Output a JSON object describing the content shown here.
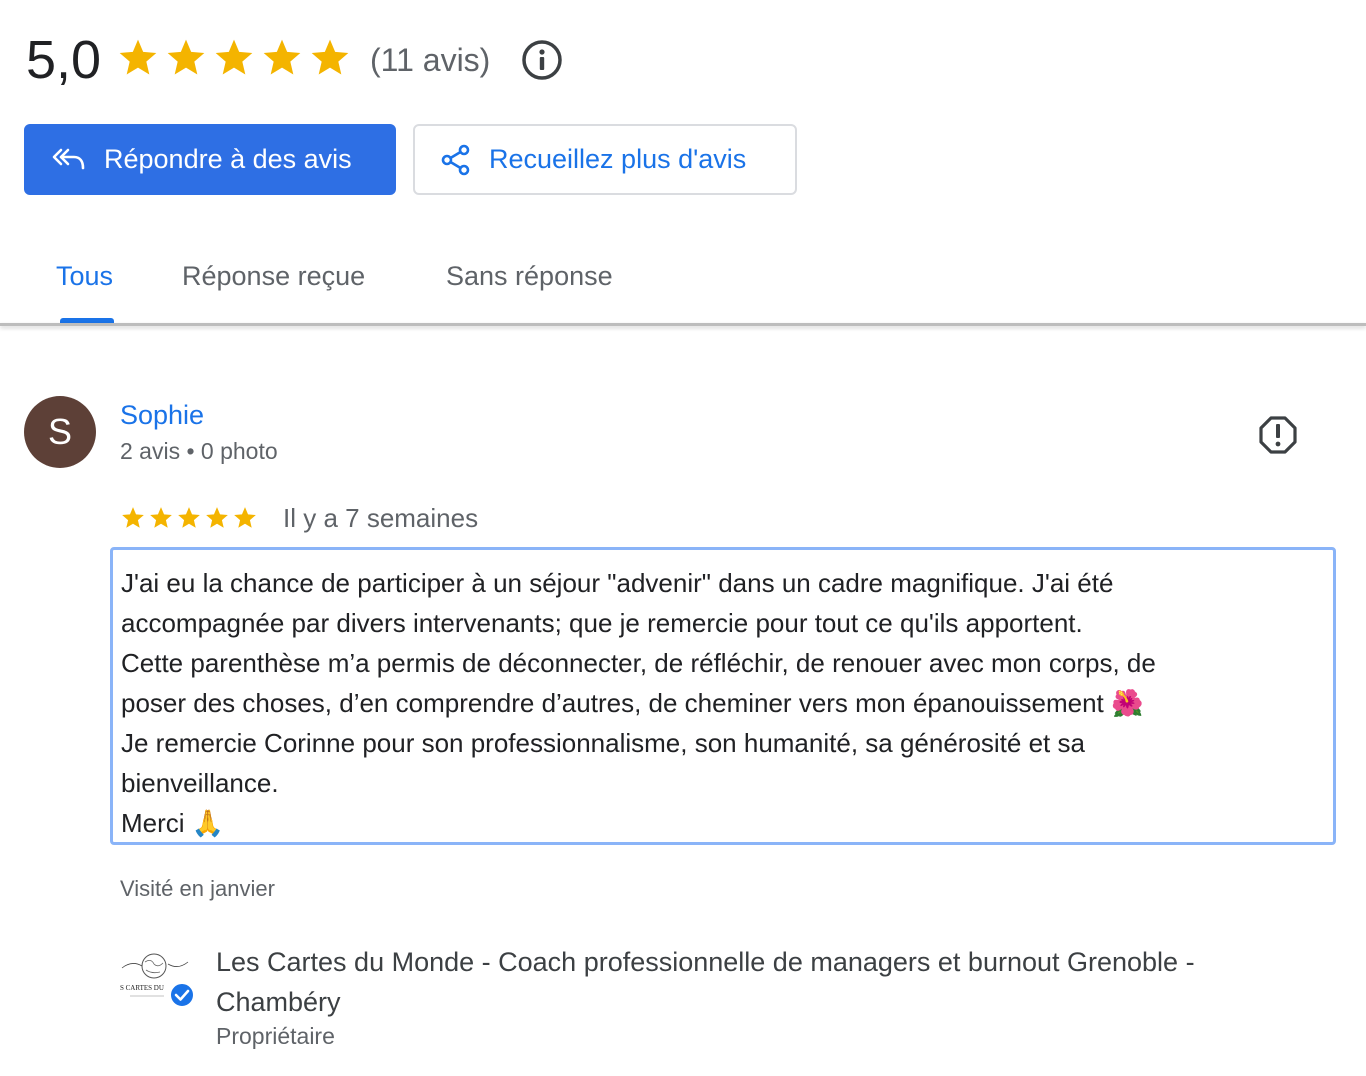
{
  "summary": {
    "rating": "5,0",
    "stars": 5,
    "count_label": "(11 avis)",
    "star_color": "#f4b400"
  },
  "actions": {
    "reply_label": "Répondre à des avis",
    "collect_label": "Recueillez plus d'avis"
  },
  "tabs": [
    {
      "label": "Tous",
      "active": true
    },
    {
      "label": "Réponse reçue",
      "active": false
    },
    {
      "label": "Sans réponse",
      "active": false
    }
  ],
  "review": {
    "avatar_letter": "S",
    "name": "Sophie",
    "meta": "2 avis • 0 photo",
    "stars": 5,
    "time": "Il y a 7 semaines",
    "text": "J'ai eu la chance de participer à un séjour \"advenir\" dans un cadre magnifique. J'ai été\naccompagnée par divers intervenants; que je remercie pour tout ce qu'ils apportent.\nCette parenthèse m’a permis de déconnecter, de réfléchir, de renouer avec mon corps, de\nposer des choses, d’en comprendre d’autres, de cheminer vers mon épanouissement 🌺\nJe remercie Corinne pour son professionnalisme, son humanité, sa générosité et sa\nbienveillance.\nMerci 🙏",
    "visited": "Visité en janvier"
  },
  "owner": {
    "logo_text": "S CARTES DU",
    "name": "Les Cartes du Monde - Coach professionnelle de managers et burnout Grenoble - Chambéry",
    "role": "Propriétaire"
  },
  "colors": {
    "primary": "#2e6fe4",
    "link": "#1a73e8",
    "avatar_bg": "#5d4037",
    "focus_border": "#8ab4f8"
  }
}
